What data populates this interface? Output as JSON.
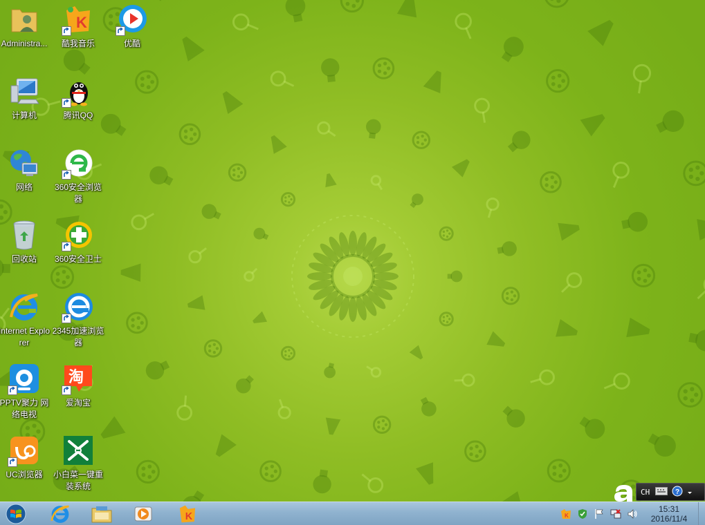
{
  "desktop": {
    "icons": [
      {
        "label": "Administra...",
        "icon": "user-folder-icon",
        "shortcut": false
      },
      {
        "label": "酷我音乐",
        "icon": "kuwo-music-icon",
        "shortcut": true
      },
      {
        "label": "优酷",
        "icon": "youku-icon",
        "shortcut": true
      },
      {
        "label": "计算机",
        "icon": "computer-icon",
        "shortcut": false
      },
      {
        "label": "腾讯QQ",
        "icon": "qq-penguin-icon",
        "shortcut": true
      },
      {
        "label": "网络",
        "icon": "network-globe-icon",
        "shortcut": false
      },
      {
        "label": "360安全浏览器",
        "icon": "360-browser-icon",
        "shortcut": true
      },
      {
        "label": "回收站",
        "icon": "recycle-bin-icon",
        "shortcut": false
      },
      {
        "label": "360安全卫士",
        "icon": "360-security-icon",
        "shortcut": true
      },
      {
        "label": "Internet Explorer",
        "icon": "internet-explorer-icon",
        "shortcut": false
      },
      {
        "label": "2345加速浏览器",
        "icon": "2345-browser-icon",
        "shortcut": true
      },
      {
        "label": "PPTV聚力 网络电视",
        "icon": "pptv-icon",
        "shortcut": true
      },
      {
        "label": "爱淘宝",
        "icon": "taobao-icon",
        "shortcut": true
      },
      {
        "label": "UC浏览器",
        "icon": "uc-browser-icon",
        "shortcut": true
      },
      {
        "label": "小白菜一键重装系统",
        "icon": "xiaobaicai-icon",
        "shortcut": false
      }
    ]
  },
  "language_bar": {
    "language": "CH",
    "icons": [
      "keyboard-icon",
      "help-icon",
      "options-arrow-icon"
    ]
  },
  "taskbar": {
    "start": "windows-start-orb-icon",
    "pinned": [
      "internet-explorer-icon",
      "file-explorer-icon",
      "media-player-icon",
      "kuwo-music-icon"
    ],
    "tray_icons": [
      "kuwo-tray-icon",
      "security-shield-icon",
      "action-center-flag-icon",
      "network-icon",
      "volume-icon"
    ],
    "clock": {
      "time": "15:31",
      "date": "2016/11/4"
    }
  },
  "colors": {
    "wallpaper_center": "#b6d84a",
    "wallpaper_edge": "#76ad18",
    "taskbar": "#8fb2cf"
  }
}
